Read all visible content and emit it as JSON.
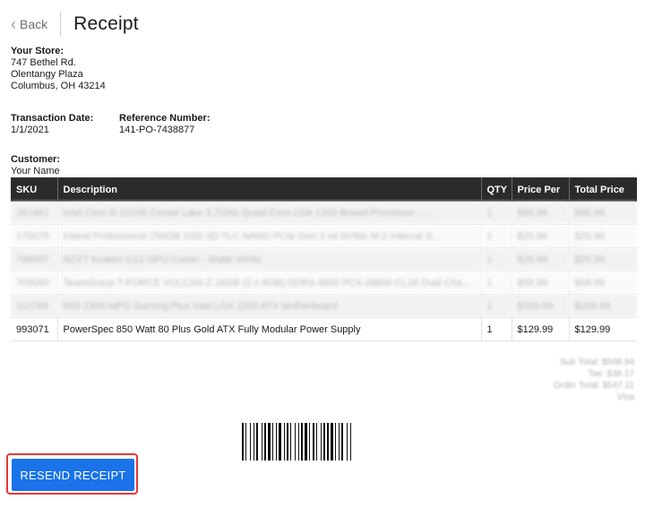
{
  "header": {
    "back_label": "Back",
    "title": "Receipt"
  },
  "store": {
    "label": "Your Store:",
    "line1": "747 Bethel Rd.",
    "line2": "Olentangy Plaza",
    "line3": "Columbus, OH 43214"
  },
  "transaction": {
    "date_label": "Transaction Date:",
    "date": "1/1/2021"
  },
  "reference": {
    "label": "Reference Number:",
    "value": "141-PO-7438877"
  },
  "customer": {
    "label": "Customer:",
    "name": "Your Name"
  },
  "table": {
    "headers": [
      "SKU",
      "Description",
      "QTY",
      "Price Per",
      "Total Price"
    ],
    "rows": [
      [
        "261461",
        "Intel Core i5-10105 Comet Lake 3.7GHz Quad-Core LGA 1200 Boxed Processor - ...",
        "1",
        "$85.99",
        "$85.99"
      ],
      [
        "170075",
        "Inland Professional 256GB SSD 3D TLC NAND PCIe Gen 3 x4 NVMe M.2 Internal S...",
        "1",
        "$25.99",
        "$25.99"
      ],
      [
        "799007",
        "NZXT Kraken G12 GPU Cooler - Matte White",
        "1",
        "$25.99",
        "$25.99"
      ],
      [
        "703060",
        "TeamGroup T-FORCE VULCAN Z 16GB (2 x 8GB) DDR4-3600 PC4-28800 CL18 Dual Cha...",
        "1",
        "$58.99",
        "$58.99"
      ],
      [
        "112789",
        "MSI Z490 MPG Gaming Plus Intel LGA 1200 ATX Motherboard",
        "1",
        "$169.99",
        "$169.99"
      ],
      [
        "993071",
        "PowerSpec 850 Watt 80 Plus Gold ATX Fully Modular Power Supply",
        "1",
        "$129.99",
        "$129.99"
      ]
    ]
  },
  "totals": {
    "subtotal": "Sub Total: $508.94",
    "tax": "Tax: $38.17",
    "order_total": "Order Total: $547.11",
    "payment": "Visa"
  },
  "actions": {
    "resend_label": "RESEND RECEIPT"
  },
  "colors": {
    "accent": "#1a73e8",
    "highlight": "#e53935",
    "table_header": "#2b2b2b"
  }
}
